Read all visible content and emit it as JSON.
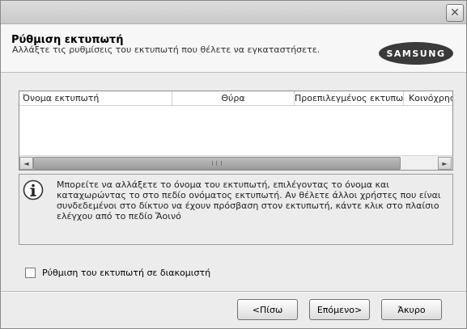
{
  "window": {
    "close_glyph": "✕"
  },
  "header": {
    "title": "Ρύθμιση εκτυπωτή",
    "subtitle": "Αλλάξτε τις ρυθμίσεις του εκτυπωτή που θέλετε να εγκαταστήσετε.",
    "logo_text": "SAMSUNG"
  },
  "printer_list": {
    "columns": [
      "Όνομα εκτυπωτή",
      "Θύρα",
      "Προεπιλεγμένος εκτυπωτής",
      "Κοινόχρηστος"
    ],
    "rows": [],
    "scroll_left_glyph": "◄",
    "scroll_right_glyph": "►"
  },
  "info": {
    "icon": "info-icon",
    "text": "Μπορείτε να αλλάξετε το όνομα του εκτυπωτή, επιλέγοντας το όνομα και καταχωρώντας το στο πεδίο ονόματος εκτυπωτή. Αν θέλετε άλλοι χρήστες που είναι συνδεδεμένοι στο δίκτυο να έχουν πρόσβαση στον εκτυπωτή, κάντε κλικ στο πλαίσιο ελέγχου από το πεδίο Ἄοινό"
  },
  "server_option": {
    "label": "Ρύθμιση του εκτυπωτή σε διακομιστή",
    "checked": false
  },
  "buttons": {
    "back": "<Πίσω",
    "next": "Επόμενο>",
    "cancel": "Άκυρο"
  }
}
